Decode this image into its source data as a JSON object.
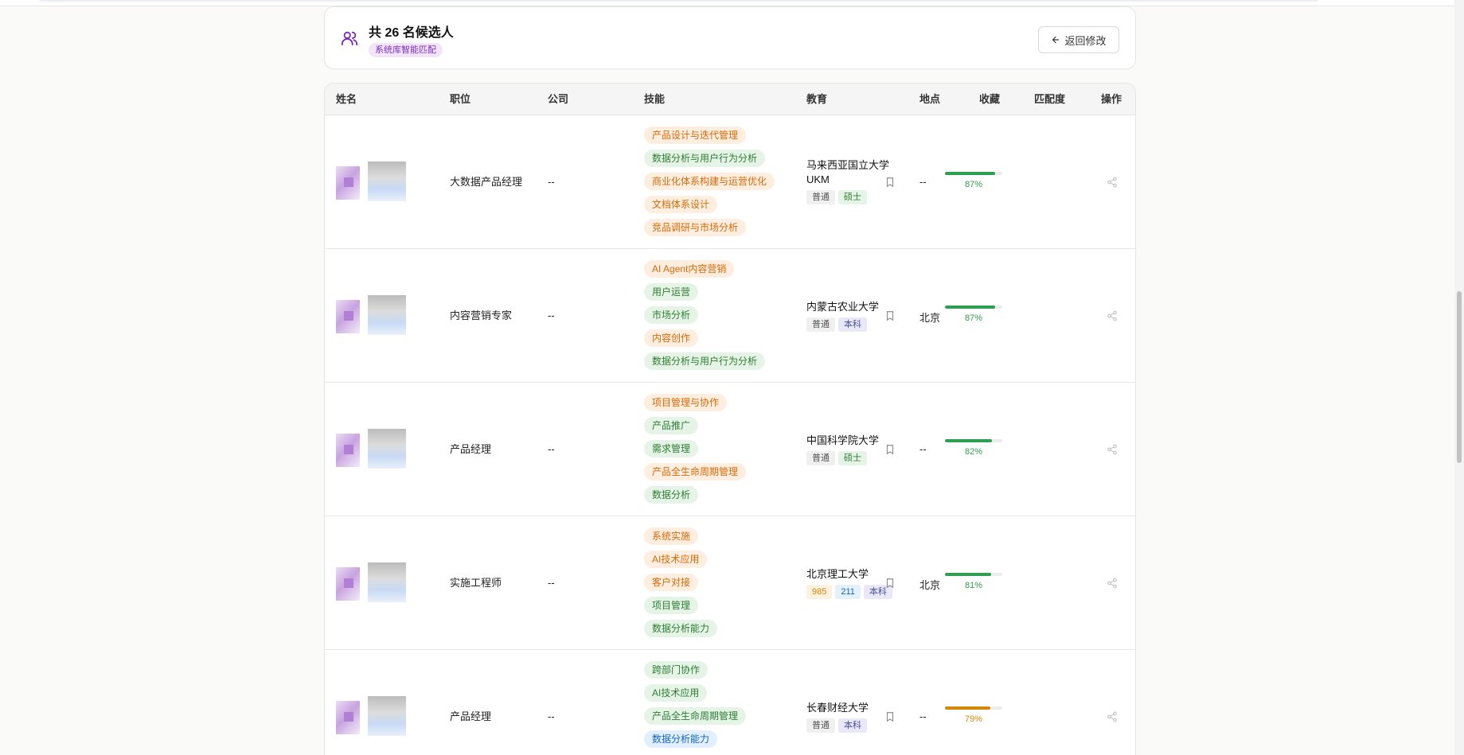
{
  "header": {
    "title": "共 26 名候选人",
    "source_badge": "系统库智能匹配",
    "back_label": "返回修改",
    "icons": {
      "users": "users-icon",
      "back": "arrow-left-icon"
    }
  },
  "table": {
    "columns": [
      "姓名",
      "职位",
      "公司",
      "技能",
      "教育",
      "地点",
      "收藏",
      "匹配度",
      "操作"
    ],
    "rows": [
      {
        "position": "大数据产品经理",
        "company": "--",
        "skills": [
          {
            "label": "产品设计与迭代管理",
            "color": "orange"
          },
          {
            "label": "数据分析与用户行为分析",
            "color": "green"
          },
          {
            "label": "商业化体系构建与运营优化",
            "color": "orange"
          },
          {
            "label": "文档体系设计",
            "color": "orange"
          },
          {
            "label": "竞品调研与市场分析",
            "color": "orange"
          }
        ],
        "school": "马来西亚国立大学UKM",
        "edu_badges": [
          {
            "label": "普通",
            "type": "normal"
          },
          {
            "label": "硕士",
            "type": "master"
          }
        ],
        "location": "--",
        "match": 87,
        "match_label": "87%",
        "match_color": "#2e9e4f"
      },
      {
        "position": "内容营销专家",
        "company": "--",
        "skills": [
          {
            "label": "AI Agent内容营销",
            "color": "orange"
          },
          {
            "label": "用户运营",
            "color": "green"
          },
          {
            "label": "市场分析",
            "color": "green"
          },
          {
            "label": "内容创作",
            "color": "orange"
          },
          {
            "label": "数据分析与用户行为分析",
            "color": "green"
          }
        ],
        "school": "内蒙古农业大学",
        "edu_badges": [
          {
            "label": "普通",
            "type": "normal"
          },
          {
            "label": "本科",
            "type": "bachelor"
          }
        ],
        "location": "北京",
        "match": 87,
        "match_label": "87%",
        "match_color": "#2e9e4f"
      },
      {
        "position": "产品经理",
        "company": "--",
        "skills": [
          {
            "label": "项目管理与协作",
            "color": "orange"
          },
          {
            "label": "产品推广",
            "color": "green"
          },
          {
            "label": "需求管理",
            "color": "green"
          },
          {
            "label": "产品全生命周期管理",
            "color": "orange"
          },
          {
            "label": "数据分析",
            "color": "green"
          }
        ],
        "school": "中国科学院大学",
        "edu_badges": [
          {
            "label": "普通",
            "type": "normal"
          },
          {
            "label": "硕士",
            "type": "master"
          }
        ],
        "location": "--",
        "match": 82,
        "match_label": "82%",
        "match_color": "#2e9e4f"
      },
      {
        "position": "实施工程师",
        "company": "--",
        "skills": [
          {
            "label": "系统实施",
            "color": "orange"
          },
          {
            "label": "AI技术应用",
            "color": "orange"
          },
          {
            "label": "客户对接",
            "color": "orange"
          },
          {
            "label": "项目管理",
            "color": "green"
          },
          {
            "label": "数据分析能力",
            "color": "green"
          }
        ],
        "school": "北京理工大学",
        "edu_badges": [
          {
            "label": "985",
            "type": "b985"
          },
          {
            "label": "211",
            "type": "b211"
          },
          {
            "label": "本科",
            "type": "bachelor"
          }
        ],
        "location": "北京",
        "match": 81,
        "match_label": "81%",
        "match_color": "#2e9e4f"
      },
      {
        "position": "产品经理",
        "company": "--",
        "skills": [
          {
            "label": "跨部门协作",
            "color": "green"
          },
          {
            "label": "AI技术应用",
            "color": "green"
          },
          {
            "label": "产品全生命周期管理",
            "color": "green"
          },
          {
            "label": "数据分析能力",
            "color": "blue"
          }
        ],
        "school": "长春财经大学",
        "edu_badges": [
          {
            "label": "普通",
            "type": "normal"
          },
          {
            "label": "本科",
            "type": "bachelor"
          }
        ],
        "location": "--",
        "match": 79,
        "match_label": "79%",
        "match_color": "#d48806"
      }
    ]
  }
}
